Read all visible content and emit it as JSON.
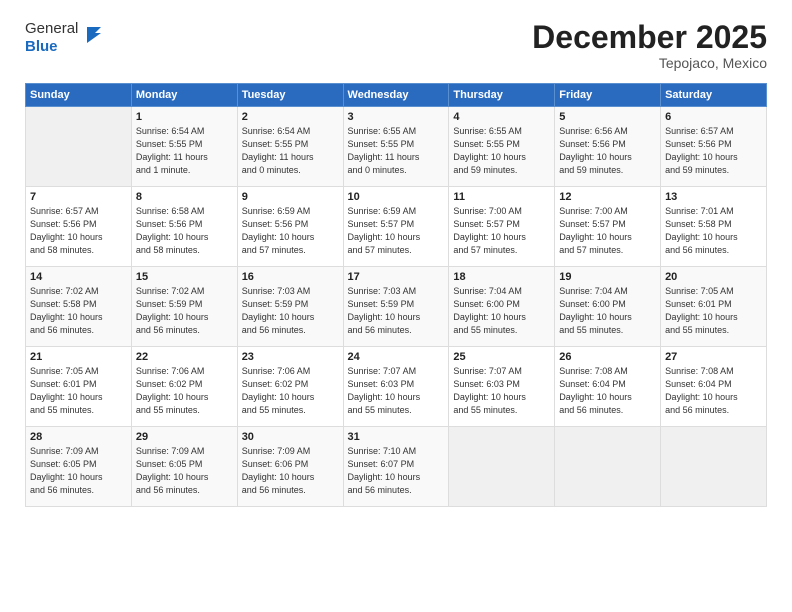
{
  "header": {
    "logo_general": "General",
    "logo_blue": "Blue",
    "month": "December 2025",
    "location": "Tepojaco, Mexico"
  },
  "days_of_week": [
    "Sunday",
    "Monday",
    "Tuesday",
    "Wednesday",
    "Thursday",
    "Friday",
    "Saturday"
  ],
  "weeks": [
    [
      {
        "num": "",
        "info": ""
      },
      {
        "num": "1",
        "info": "Sunrise: 6:54 AM\nSunset: 5:55 PM\nDaylight: 11 hours\nand 1 minute."
      },
      {
        "num": "2",
        "info": "Sunrise: 6:54 AM\nSunset: 5:55 PM\nDaylight: 11 hours\nand 0 minutes."
      },
      {
        "num": "3",
        "info": "Sunrise: 6:55 AM\nSunset: 5:55 PM\nDaylight: 11 hours\nand 0 minutes."
      },
      {
        "num": "4",
        "info": "Sunrise: 6:55 AM\nSunset: 5:55 PM\nDaylight: 10 hours\nand 59 minutes."
      },
      {
        "num": "5",
        "info": "Sunrise: 6:56 AM\nSunset: 5:56 PM\nDaylight: 10 hours\nand 59 minutes."
      },
      {
        "num": "6",
        "info": "Sunrise: 6:57 AM\nSunset: 5:56 PM\nDaylight: 10 hours\nand 59 minutes."
      }
    ],
    [
      {
        "num": "7",
        "info": "Sunrise: 6:57 AM\nSunset: 5:56 PM\nDaylight: 10 hours\nand 58 minutes."
      },
      {
        "num": "8",
        "info": "Sunrise: 6:58 AM\nSunset: 5:56 PM\nDaylight: 10 hours\nand 58 minutes."
      },
      {
        "num": "9",
        "info": "Sunrise: 6:59 AM\nSunset: 5:56 PM\nDaylight: 10 hours\nand 57 minutes."
      },
      {
        "num": "10",
        "info": "Sunrise: 6:59 AM\nSunset: 5:57 PM\nDaylight: 10 hours\nand 57 minutes."
      },
      {
        "num": "11",
        "info": "Sunrise: 7:00 AM\nSunset: 5:57 PM\nDaylight: 10 hours\nand 57 minutes."
      },
      {
        "num": "12",
        "info": "Sunrise: 7:00 AM\nSunset: 5:57 PM\nDaylight: 10 hours\nand 57 minutes."
      },
      {
        "num": "13",
        "info": "Sunrise: 7:01 AM\nSunset: 5:58 PM\nDaylight: 10 hours\nand 56 minutes."
      }
    ],
    [
      {
        "num": "14",
        "info": "Sunrise: 7:02 AM\nSunset: 5:58 PM\nDaylight: 10 hours\nand 56 minutes."
      },
      {
        "num": "15",
        "info": "Sunrise: 7:02 AM\nSunset: 5:59 PM\nDaylight: 10 hours\nand 56 minutes."
      },
      {
        "num": "16",
        "info": "Sunrise: 7:03 AM\nSunset: 5:59 PM\nDaylight: 10 hours\nand 56 minutes."
      },
      {
        "num": "17",
        "info": "Sunrise: 7:03 AM\nSunset: 5:59 PM\nDaylight: 10 hours\nand 56 minutes."
      },
      {
        "num": "18",
        "info": "Sunrise: 7:04 AM\nSunset: 6:00 PM\nDaylight: 10 hours\nand 55 minutes."
      },
      {
        "num": "19",
        "info": "Sunrise: 7:04 AM\nSunset: 6:00 PM\nDaylight: 10 hours\nand 55 minutes."
      },
      {
        "num": "20",
        "info": "Sunrise: 7:05 AM\nSunset: 6:01 PM\nDaylight: 10 hours\nand 55 minutes."
      }
    ],
    [
      {
        "num": "21",
        "info": "Sunrise: 7:05 AM\nSunset: 6:01 PM\nDaylight: 10 hours\nand 55 minutes."
      },
      {
        "num": "22",
        "info": "Sunrise: 7:06 AM\nSunset: 6:02 PM\nDaylight: 10 hours\nand 55 minutes."
      },
      {
        "num": "23",
        "info": "Sunrise: 7:06 AM\nSunset: 6:02 PM\nDaylight: 10 hours\nand 55 minutes."
      },
      {
        "num": "24",
        "info": "Sunrise: 7:07 AM\nSunset: 6:03 PM\nDaylight: 10 hours\nand 55 minutes."
      },
      {
        "num": "25",
        "info": "Sunrise: 7:07 AM\nSunset: 6:03 PM\nDaylight: 10 hours\nand 55 minutes."
      },
      {
        "num": "26",
        "info": "Sunrise: 7:08 AM\nSunset: 6:04 PM\nDaylight: 10 hours\nand 56 minutes."
      },
      {
        "num": "27",
        "info": "Sunrise: 7:08 AM\nSunset: 6:04 PM\nDaylight: 10 hours\nand 56 minutes."
      }
    ],
    [
      {
        "num": "28",
        "info": "Sunrise: 7:09 AM\nSunset: 6:05 PM\nDaylight: 10 hours\nand 56 minutes."
      },
      {
        "num": "29",
        "info": "Sunrise: 7:09 AM\nSunset: 6:05 PM\nDaylight: 10 hours\nand 56 minutes."
      },
      {
        "num": "30",
        "info": "Sunrise: 7:09 AM\nSunset: 6:06 PM\nDaylight: 10 hours\nand 56 minutes."
      },
      {
        "num": "31",
        "info": "Sunrise: 7:10 AM\nSunset: 6:07 PM\nDaylight: 10 hours\nand 56 minutes."
      },
      {
        "num": "",
        "info": ""
      },
      {
        "num": "",
        "info": ""
      },
      {
        "num": "",
        "info": ""
      }
    ]
  ]
}
